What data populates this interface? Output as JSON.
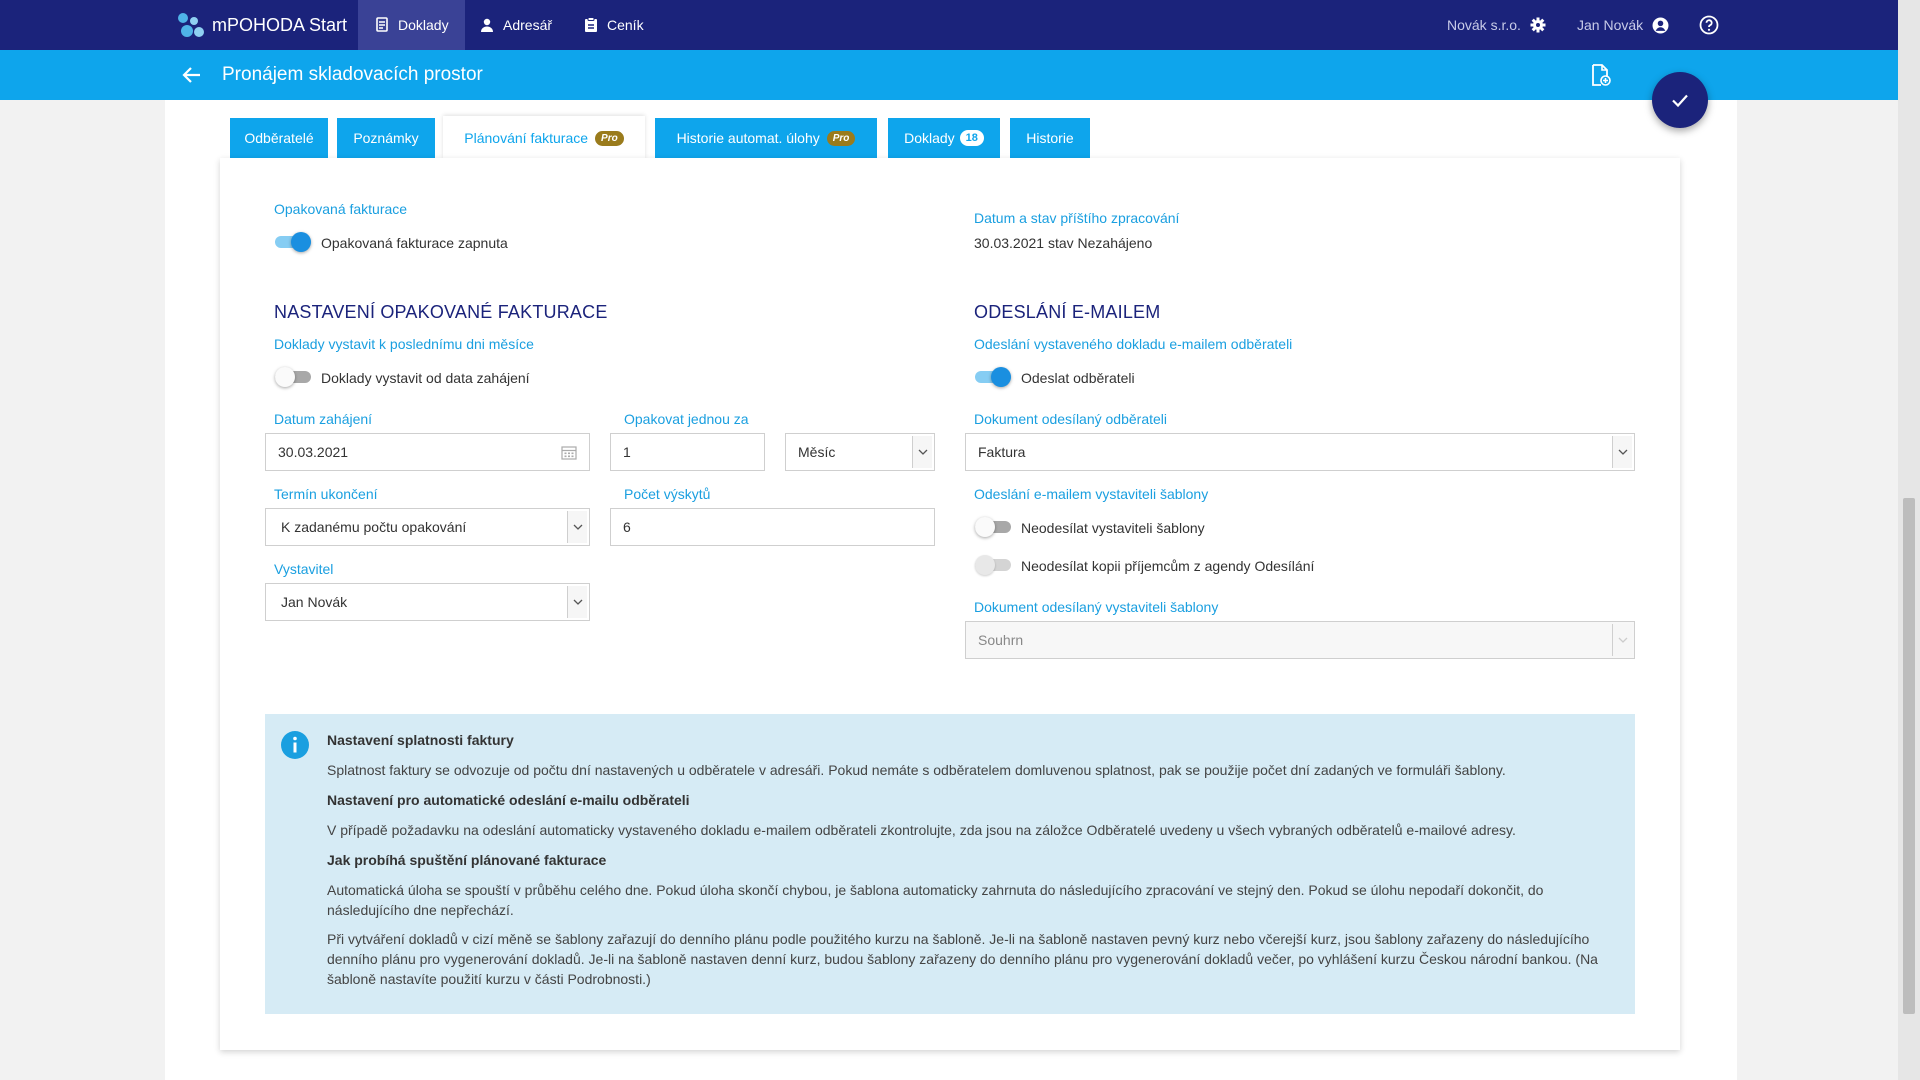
{
  "nav": {
    "brand": "mPOHODA Start",
    "items": [
      {
        "label": "Doklady",
        "icon": "documents-icon"
      },
      {
        "label": "Adresář",
        "icon": "person-icon"
      },
      {
        "label": "Ceník",
        "icon": "pricelist-icon"
      }
    ],
    "company": "Novák s.r.o.",
    "user": "Jan Novák"
  },
  "header": {
    "title": "Pronájem skladovacích prostor"
  },
  "tabs": [
    {
      "label": "Odběratelé"
    },
    {
      "label": "Poznámky"
    },
    {
      "label": "Plánování fakturace",
      "badge": "Pro"
    },
    {
      "label": "Historie automat. úlohy",
      "badge": "Pro"
    },
    {
      "label": "Doklady",
      "count": "18"
    },
    {
      "label": "Historie"
    }
  ],
  "recurring": {
    "label": "Opakovaná fakturace",
    "toggle_label": "Opakovaná fakturace zapnuta"
  },
  "next_run": {
    "label": "Datum a stav příštího zpracování",
    "value": "30.03.2021 stav Nezahájeno"
  },
  "settings": {
    "heading": "NASTAVENÍ OPAKOVANÉ FAKTURACE",
    "end_of_month_label": "Doklady vystavit k poslednímu dni měsíce",
    "from_start_toggle": "Doklady vystavit od data zahájení",
    "start_date_label": "Datum zahájení",
    "start_date_value": "30.03.2021",
    "repeat_label": "Opakovat jednou za",
    "repeat_value": "1",
    "repeat_unit": "Měsíc",
    "end_label": "Termín ukončení",
    "end_value": "K zadanému počtu opakování",
    "count_label": "Počet výskytů",
    "count_value": "6",
    "issuer_label": "Vystavitel",
    "issuer_value": "Jan Novák"
  },
  "email": {
    "heading": "ODESLÁNÍ E-MAILEM",
    "send_label": "Odeslání vystaveného dokladu e-mailem odběrateli",
    "send_toggle": "Odeslat odběrateli",
    "doc_label": "Dokument odesílaný odběrateli",
    "doc_value": "Faktura",
    "template_label": "Odeslání e-mailem vystaviteli šablony",
    "template_toggle": "Neodesílat vystaviteli šablony",
    "copy_toggle": "Neodesílat kopii příjemcům z agendy Odesílání",
    "template_doc_label": "Dokument odesílaný vystaviteli šablony",
    "template_doc_value": "Souhrn"
  },
  "info": {
    "h1": "Nastavení splatnosti faktury",
    "p1": "Splatnost faktury se odvozuje od počtu dní nastavených u odběratele v adresáři. Pokud nemáte s odběratelem domluvenou splatnost, pak se použije počet dní zadaných ve formuláři šablony.",
    "h2": "Nastavení pro automatické odeslání e-mailu odběrateli",
    "p2": "V případě požadavku na odeslání automaticky vystaveného dokladu e-mailem odběrateli zkontrolujte, zda jsou na záložce Odběratelé uvedeny u všech vybraných odběratelů e-mailové adresy.",
    "h3": "Jak probíhá spuštění plánované fakturace",
    "p3": "Automatická úloha se spouští v průběhu celého dne. Pokud úloha skončí chybou, je šablona automaticky zahrnuta do následujícího zpracování ve stejný den. Pokud se úlohu nepodaří dokončit, do následujícího dne nepřechází.",
    "p4": "Při vytváření dokladů v cizí měně se šablony zařazují do denního plánu podle použitého kurzu na šabloně. Je-li na šabloně nastaven pevný kurz nebo včerejší kurz, jsou šablony zařazeny do následujícího denního plánu pro vygenerování dokladů. Je-li na šabloně nastaven denní kurz, budou šablony zařazeny do denního plánu pro vygenerování dokladů večer, po vyhlášení kurzu Českou národní bankou. (Na šabloně nastavíte použití kurzu v části Podrobnosti.)"
  }
}
